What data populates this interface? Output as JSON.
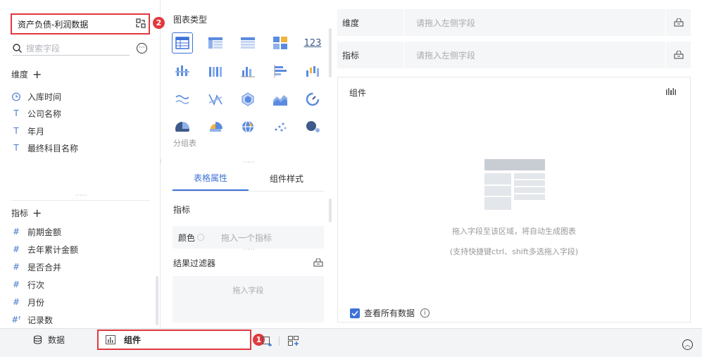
{
  "datasource": {
    "name": "资产负债-利润数据",
    "badge": "2"
  },
  "search": {
    "placeholder": "搜索字段"
  },
  "dimensions": {
    "title": "维度",
    "items": [
      {
        "label": "入库时间",
        "icon": "clock-icon"
      },
      {
        "label": "公司名称",
        "icon": "text-type-icon"
      },
      {
        "label": "年月",
        "icon": "text-type-icon"
      },
      {
        "label": "最终科目名称",
        "icon": "text-type-icon"
      }
    ]
  },
  "metrics": {
    "title": "指标",
    "items": [
      {
        "label": "前期金额",
        "icon": "number-type-icon"
      },
      {
        "label": "去年累计金额",
        "icon": "number-type-icon"
      },
      {
        "label": "是否合并",
        "icon": "number-type-icon"
      },
      {
        "label": "行次",
        "icon": "number-type-icon"
      },
      {
        "label": "月份",
        "icon": "number-type-icon"
      },
      {
        "label": "记录数",
        "icon": "number-type-icon"
      }
    ]
  },
  "chart_types": {
    "title": "图表类型",
    "group_label": "分组表",
    "number_icon_text": "123"
  },
  "tabs": [
    {
      "label": "表格属性",
      "active": true
    },
    {
      "label": "组件样式",
      "active": false
    }
  ],
  "properties": {
    "metric_label": "指标",
    "color_label": "颜色",
    "color_placeholder": "拖入一个指标",
    "filter_label": "结果过滤器",
    "filter_placeholder": "拖入字段"
  },
  "drop_zones": {
    "dimension": {
      "label": "维度",
      "placeholder": "请拖入左侧字段"
    },
    "metric": {
      "label": "指标",
      "placeholder": "请拖入左侧字段"
    }
  },
  "canvas": {
    "title": "组件",
    "hint_main": "拖入字段至该区域，将自动生成图表",
    "hint_sub": "(支持快捷键ctrl、shift多选拖入字段)",
    "view_all_label": "查看所有数据",
    "view_all_checked": true
  },
  "bottom_bar": {
    "data_tab": "数据",
    "component_tab": "组件",
    "component_badge": "1"
  },
  "colors": {
    "accent": "#3d72d8",
    "highlight_border": "#e0393e",
    "field_icon": "#4a7bd0"
  }
}
